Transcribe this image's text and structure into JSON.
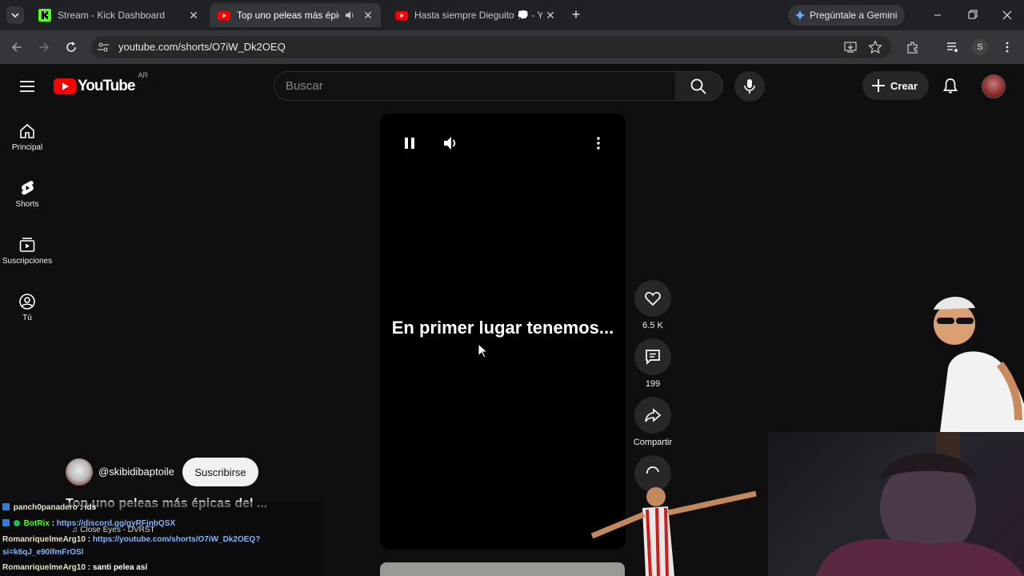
{
  "browser": {
    "tabs": [
      {
        "title": "Stream - Kick Dashboard",
        "favicon": "kick-icon"
      },
      {
        "title": "Top uno peleas más épicas",
        "favicon": "youtube-icon",
        "active": true,
        "audio": true
      },
      {
        "title": "Hasta siempre Dieguito 💭 - Y",
        "favicon": "youtube-icon"
      }
    ],
    "gemini_label": "Pregúntale a Gemini",
    "url": "youtube.com/shorts/O7iW_Dk2OEQ",
    "profile_initial": "S"
  },
  "youtube": {
    "logo_text": "YouTube",
    "country": "AR",
    "search_placeholder": "Buscar",
    "create_label": "Crear",
    "guide": [
      {
        "label": "Principal",
        "icon": "home-icon"
      },
      {
        "label": "Shorts",
        "icon": "shorts-icon"
      },
      {
        "label": "Suscripciones",
        "icon": "subscriptions-icon"
      },
      {
        "label": "Tú",
        "icon": "you-icon"
      }
    ]
  },
  "short": {
    "caption": "En primer lugar tenemos...",
    "likes": "6.5 K",
    "comments": "199",
    "share_label": "Compartir",
    "channel": "@skibidibaptoile",
    "subscribe_label": "Suscribirse",
    "title": "Top uno peleas más épicas del ..."
  },
  "chat": [
    {
      "user": "panch0panadero",
      "text": ": ids"
    },
    {
      "user": "BotRix",
      "link": "https://discord.gg/gyRFjnbQSX"
    },
    {
      "overlay": "♫ Close Eyes - DVRST"
    },
    {
      "user": "RomanriquelmeArg10",
      "link": "https://youtube.com/shorts/O7iW_Dk2OEQ?"
    },
    {
      "link": "si=k6qJ_e90lfmFrOSl"
    },
    {
      "user": "RomanriquelmeArg10",
      "text": "santi pelea así"
    }
  ],
  "colors": {
    "youtube_red": "#ff0000",
    "kick_green": "#53fc18",
    "chrome_bg": "#202124"
  }
}
